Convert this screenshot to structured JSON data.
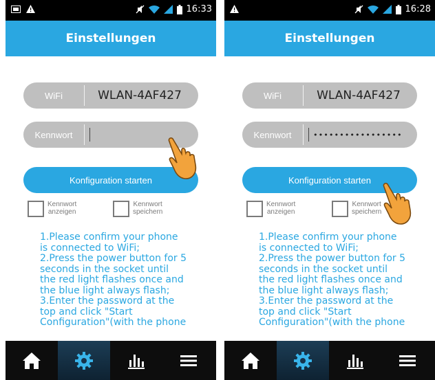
{
  "colors": {
    "accent": "#2aa7e1",
    "field_bg": "#bfbfbf",
    "statusbar": "#000000",
    "navbar": "#0d0d0d",
    "hand": "#f2a33c"
  },
  "screens": [
    {
      "status_time": "16:33",
      "title": "Einstellungen",
      "wifi_label": "WiFi",
      "wifi_value": "WLAN-4AF427",
      "password_label": "Kennwort",
      "password_value": "",
      "start_button": "Konfiguration starten",
      "checkbox_show": "Kennwort\nanzeigen",
      "checkbox_save": "Kennwort\nspeichern",
      "instructions": "1.Please confirm your phone\nis connected to WiFi;\n2.Press the power button for 5\nseconds in the socket until\nthe red light flashes once and\nthe blue light always flash;\n3.Enter the password at the\ntop and click \"Start\nConfiguration\"(with the phone",
      "nav_icons": [
        "home-icon",
        "settings-gear-icon",
        "stats-bars-icon",
        "menu-icon"
      ]
    },
    {
      "status_time": "16:28",
      "title": "Einstellungen",
      "wifi_label": "WiFi",
      "wifi_value": "WLAN-4AF427",
      "password_label": "Kennwort",
      "password_value": "•••••••••••••••••",
      "start_button": "Konfiguration starten",
      "checkbox_show": "Kennwort\nanzeigen",
      "checkbox_save": "Kennwort\nspeichern",
      "instructions": "1.Please confirm your phone\nis connected to WiFi;\n2.Press the power button for 5\nseconds in the socket until\nthe red light flashes once and\nthe blue light always flash;\n3.Enter the password at the\ntop and click \"Start\nConfiguration\"(with the phone",
      "nav_icons": [
        "home-icon",
        "settings-gear-icon",
        "stats-bars-icon",
        "menu-icon"
      ]
    }
  ]
}
